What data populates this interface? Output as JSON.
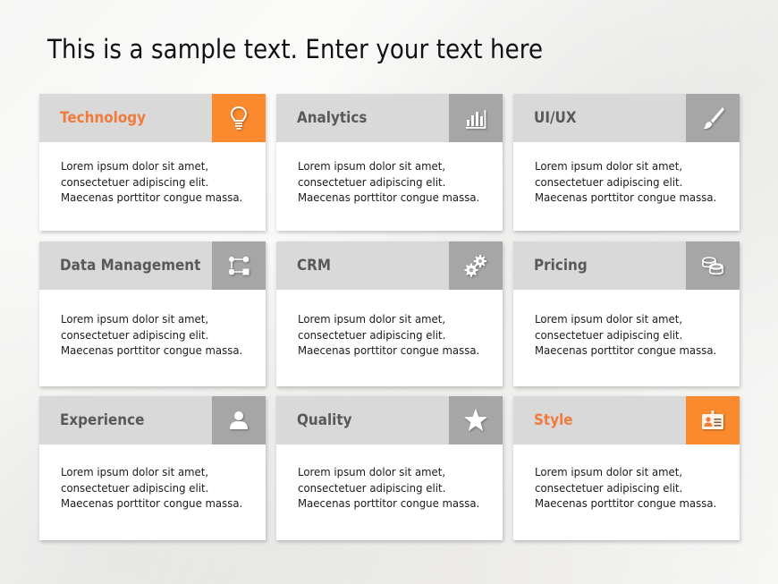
{
  "slide": {
    "title": "This is a sample text. Enter your text here"
  },
  "colors": {
    "accent": "#fb8a2e",
    "accent_text": "#f07b3c",
    "header_bg": "#d9d9d9",
    "icon_bg": "#a6a6a6",
    "title_text": "#595959"
  },
  "cards": [
    {
      "title": "Technology",
      "icon": "lightbulb-icon",
      "accent": true,
      "lines": [
        "Lorem ipsum dolor sit amet,",
        "consectetuer adipiscing elit.",
        "Maecenas porttitor  congue massa."
      ]
    },
    {
      "title": "Analytics",
      "icon": "bar-chart-icon",
      "accent": false,
      "lines": [
        "Lorem ipsum dolor sit amet,",
        "consectetuer adipiscing elit.",
        "Maecenas porttitor  congue massa."
      ]
    },
    {
      "title": "UI/UX",
      "icon": "paintbrush-icon",
      "accent": false,
      "lines": [
        "Lorem ipsum dolor sit amet,",
        "consectetuer adipiscing elit.",
        "Maecenas porttitor  congue massa."
      ]
    },
    {
      "title": "Data Management",
      "icon": "workflow-icon",
      "accent": false,
      "lines": [
        "Lorem ipsum dolor sit amet,",
        "consectetuer adipiscing elit.",
        "Maecenas porttitor  congue massa."
      ]
    },
    {
      "title": "CRM",
      "icon": "gears-icon",
      "accent": false,
      "lines": [
        "Lorem ipsum dolor sit amet,",
        "consectetuer adipiscing elit.",
        "Maecenas porttitor  congue massa."
      ]
    },
    {
      "title": "Pricing",
      "icon": "coins-icon",
      "accent": false,
      "lines": [
        "Lorem ipsum dolor sit amet,",
        "consectetuer adipiscing elit.",
        "Maecenas porttitor  congue massa."
      ]
    },
    {
      "title": "Experience",
      "icon": "user-icon",
      "accent": false,
      "lines": [
        "Lorem ipsum dolor sit amet,",
        "consectetuer adipiscing elit.",
        "Maecenas porttitor  congue massa."
      ]
    },
    {
      "title": "Quality",
      "icon": "star-icon",
      "accent": false,
      "lines": [
        "Lorem ipsum dolor sit amet,",
        "consectetuer adipiscing elit.",
        "Maecenas porttitor  congue massa."
      ]
    },
    {
      "title": "Style",
      "icon": "id-badge-icon",
      "accent": true,
      "lines": [
        "Lorem ipsum dolor sit amet,",
        "consectetuer adipiscing elit.",
        "Maecenas porttitor  congue massa."
      ]
    }
  ]
}
